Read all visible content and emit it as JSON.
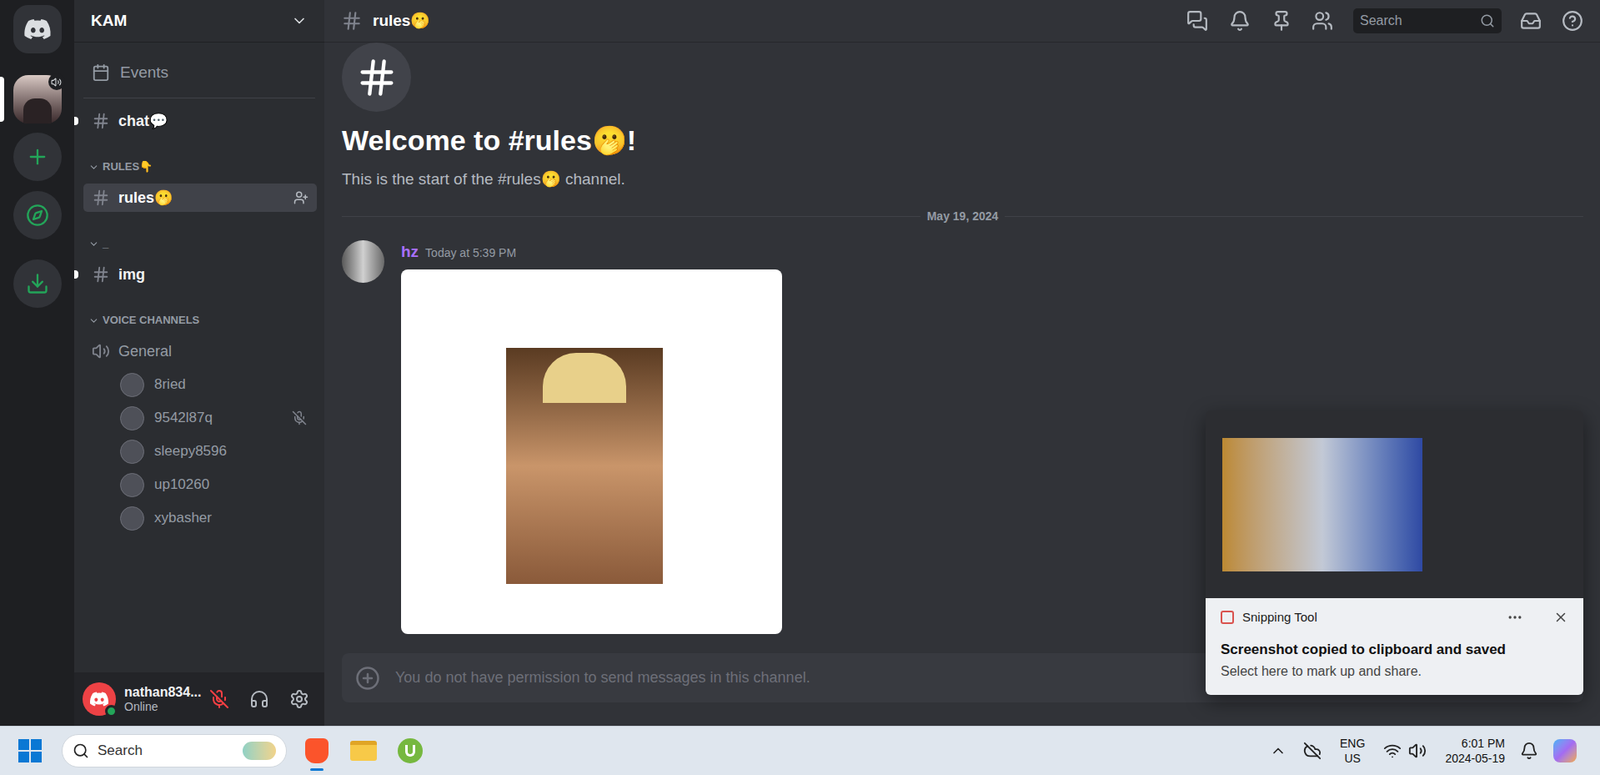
{
  "server": {
    "name": "KAM",
    "events": "Events",
    "voice_active": true
  },
  "channels": [
    {
      "kind": "text",
      "label": "chat💬",
      "unread": true,
      "selected": false
    },
    {
      "kind": "category",
      "label": "RULES👇",
      "expanded": true
    },
    {
      "kind": "text",
      "label": "rules🫢",
      "unread": false,
      "selected": true
    },
    {
      "kind": "category",
      "label": "_",
      "expanded": true
    },
    {
      "kind": "text",
      "label": "img",
      "unread": true,
      "selected": false
    },
    {
      "kind": "category",
      "label": "VOICE CHANNELS",
      "expanded": true
    },
    {
      "kind": "voice",
      "label": "General",
      "unread": false,
      "selected": false
    }
  ],
  "voice_users": [
    {
      "name": "8ried",
      "muted": false
    },
    {
      "name": "9542l87q",
      "muted": true
    },
    {
      "name": "sleepy8596",
      "muted": false
    },
    {
      "name": "up10260",
      "muted": false
    },
    {
      "name": "xybasher",
      "muted": false
    }
  ],
  "user_panel": {
    "name": "nathan834...",
    "status": "Online",
    "mic_muted": true
  },
  "header": {
    "channel": "rules🫢",
    "search_placeholder": "Search"
  },
  "welcome": {
    "title": "Welcome to #rules🫢!",
    "subtitle": "This is the start of the #rules🫢 channel."
  },
  "date_divider": "May 19, 2024",
  "message": {
    "author": "hz",
    "time": "Today at 5:39 PM"
  },
  "input": {
    "placeholder": "You do not have permission to send messages in this channel.",
    "disabled": true
  },
  "toast": {
    "app": "Snipping Tool",
    "title": "Screenshot copied to clipboard and saved",
    "body": "Select here to mark up and share."
  },
  "taskbar": {
    "search_placeholder": "Search",
    "language": "ENG",
    "region": "US",
    "time": "6:01 PM",
    "date": "2024-05-19",
    "active_app": "brave"
  }
}
